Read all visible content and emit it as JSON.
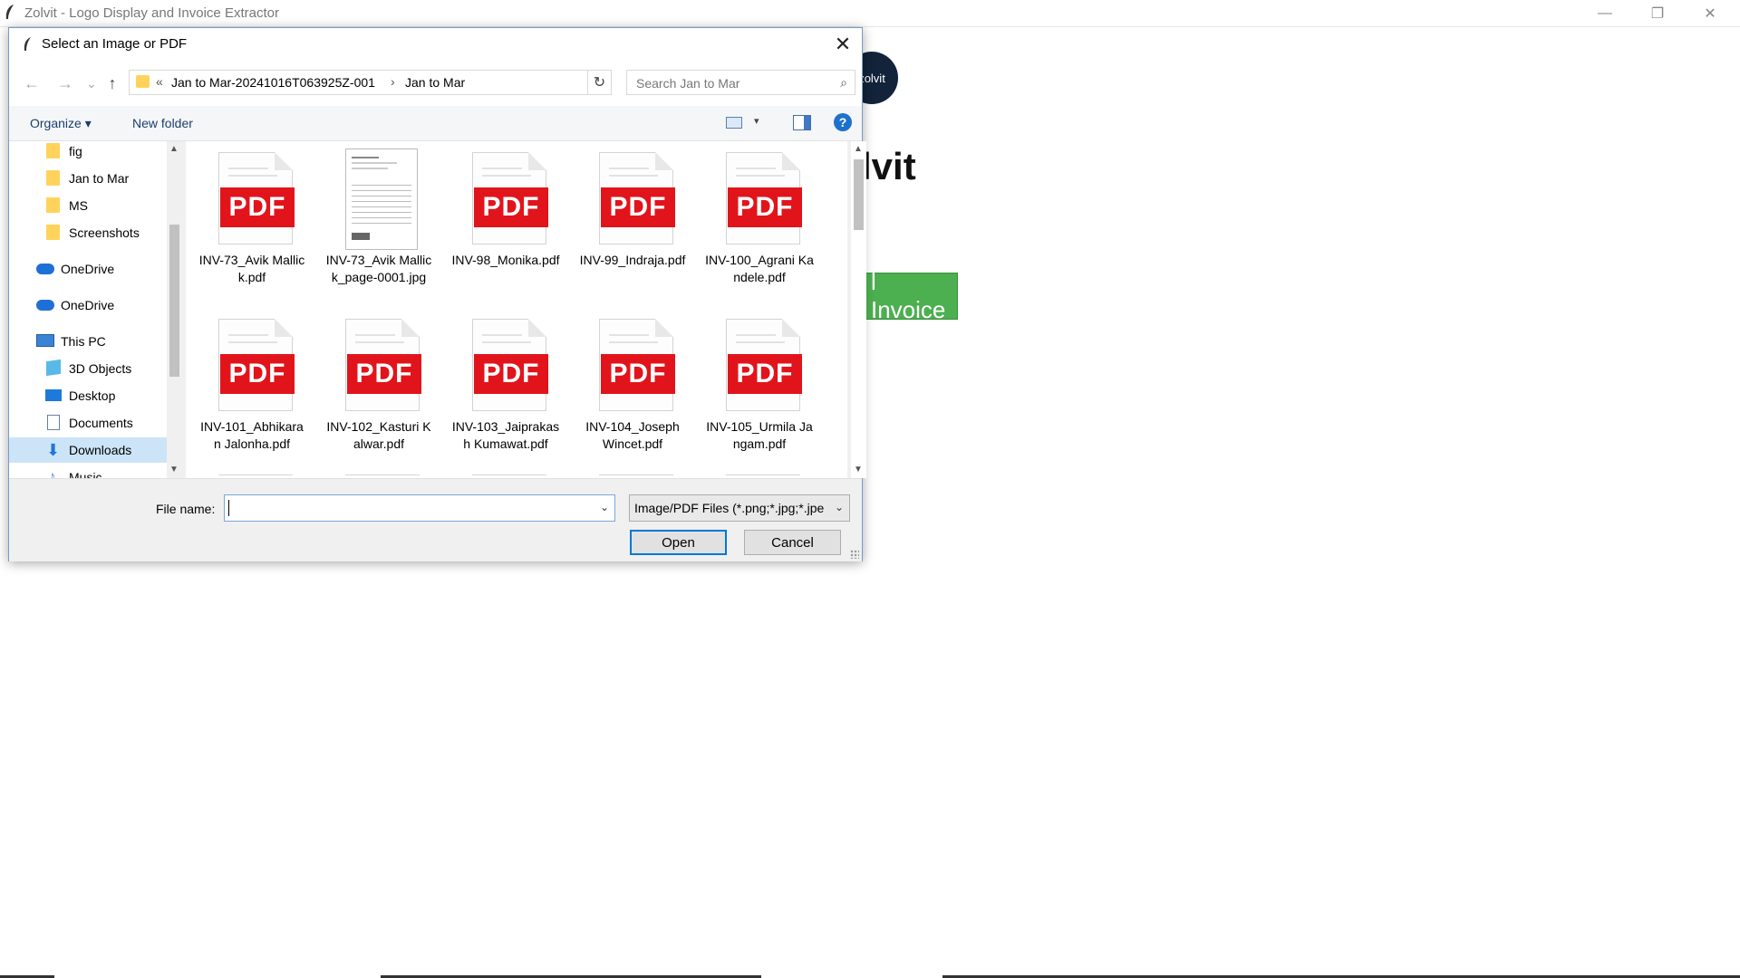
{
  "app": {
    "title": "Zolvit - Logo Display and Invoice Extractor",
    "logo_text": "zolvit",
    "heading": "lvit",
    "upload_button": "l Invoice",
    "controls": {
      "minimize": "—",
      "restore": "❐",
      "close": "✕"
    }
  },
  "dialog": {
    "title": "Select an Image or PDF",
    "close": "✕",
    "nav": {
      "back": "←",
      "forward": "→",
      "recent": "⌄",
      "up": "↑"
    },
    "breadcrumb": {
      "overflow": "«",
      "segments": [
        "Jan to Mar-20241016T063925Z-001",
        "Jan to Mar"
      ],
      "separator": "›"
    },
    "address_dropdown": "⌄",
    "refresh": "↻",
    "search_placeholder": "Search Jan to Mar",
    "search_glyph": "⌕",
    "toolbar": {
      "organize": "Organize ▾",
      "new_folder": "New folder",
      "view_dropdown": "▾",
      "help": "?"
    },
    "nav_pane": [
      {
        "label": "fig",
        "icon": "folder-icon"
      },
      {
        "label": "Jan to Mar",
        "icon": "folder-icon"
      },
      {
        "label": "MS",
        "icon": "folder-icon"
      },
      {
        "label": "Screenshots",
        "icon": "folder-icon"
      },
      {
        "label": "OneDrive",
        "icon": "cloud-icon"
      },
      {
        "label": "OneDrive",
        "icon": "cloud-icon"
      },
      {
        "label": "This PC",
        "icon": "computer-icon"
      },
      {
        "label": "3D Objects",
        "icon": "cube-icon"
      },
      {
        "label": "Desktop",
        "icon": "desktop-icon"
      },
      {
        "label": "Documents",
        "icon": "documents-icon"
      },
      {
        "label": "Downloads",
        "icon": "download-icon",
        "selected": true
      },
      {
        "label": "Music",
        "icon": "music-icon"
      }
    ],
    "files": [
      {
        "name": "INV-73_Avik Mallick.pdf",
        "type": "pdf"
      },
      {
        "name": "INV-73_Avik Mallick_page-0001.jpg",
        "type": "jpg"
      },
      {
        "name": "INV-98_Monika.pdf",
        "type": "pdf"
      },
      {
        "name": "INV-99_Indraja.pdf",
        "type": "pdf"
      },
      {
        "name": "INV-100_Agrani Kandele.pdf",
        "type": "pdf"
      },
      {
        "name": "INV-101_Abhikaran Jalonha.pdf",
        "type": "pdf"
      },
      {
        "name": "INV-102_Kasturi Kalwar.pdf",
        "type": "pdf"
      },
      {
        "name": "INV-103_Jaiprakash Kumawat.pdf",
        "type": "pdf"
      },
      {
        "name": "INV-104_Joseph Wincet.pdf",
        "type": "pdf"
      },
      {
        "name": "INV-105_Urmila Jangam.pdf",
        "type": "pdf"
      }
    ],
    "pdf_badge": "PDF",
    "file_name_label": "File name:",
    "file_name_value": "",
    "file_type": "Image/PDF Files (*.png;*.jpg;*.jpeg;*.pdf)",
    "dropdown_glyph": "⌄",
    "open_button": "Open",
    "cancel_button": "Cancel",
    "scroll_up": "▲",
    "scroll_down": "▼"
  }
}
